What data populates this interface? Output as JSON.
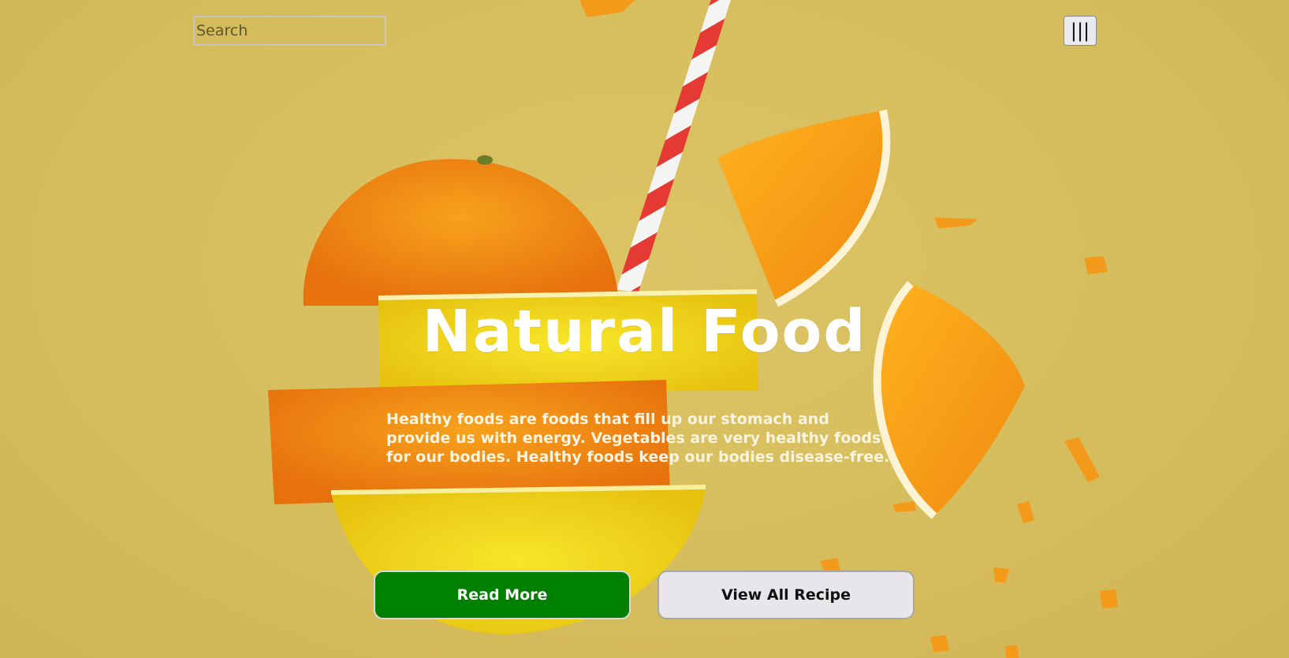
{
  "search": {
    "placeholder": "Search"
  },
  "menu": {
    "icon": "hamburger-menu-icon",
    "label": "|||"
  },
  "hero": {
    "title": "Natural Food",
    "description": "Healthy foods are foods that fill up our stomach and provide us with energy. Vegetables are very healthy foods for our bodies. Healthy foods keep our bodies disease-free.",
    "primary_button": "Read More",
    "secondary_button": "View All Recipe"
  },
  "colors": {
    "background": "#d7bf5f",
    "primary_button": "#008000",
    "secondary_button": "#e8e6ea",
    "title_text": "#ffffff"
  }
}
